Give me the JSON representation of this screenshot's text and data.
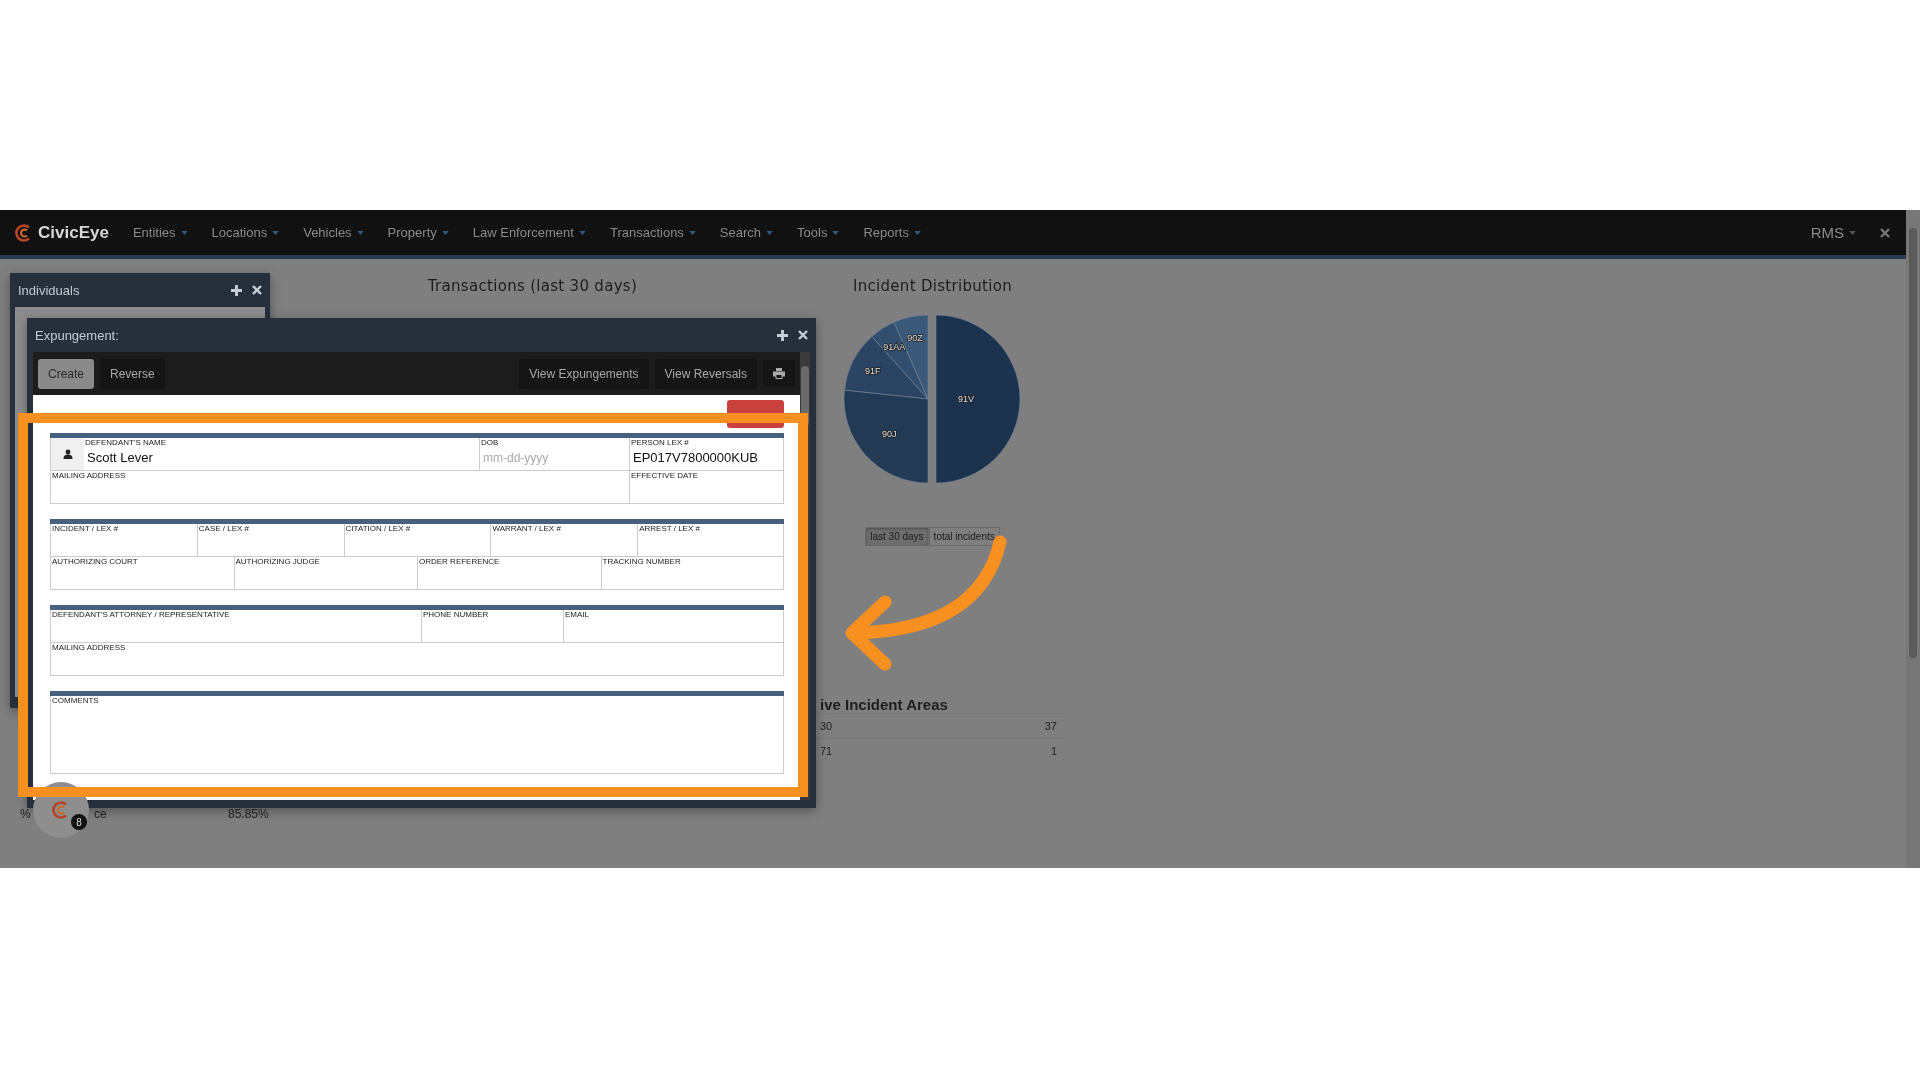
{
  "navbar": {
    "brand": "CivicEye",
    "items": [
      "Entities",
      "Locations",
      "Vehicles",
      "Property",
      "Law Enforcement",
      "Transactions",
      "Search",
      "Tools",
      "Reports"
    ],
    "user_menu": "RMS"
  },
  "dashboard": {
    "stat_row": {
      "column_1": "%",
      "column_2": "ce",
      "column_3": "85.85%"
    },
    "transactions_title": "Transactions (last 30 days)",
    "distribution": {
      "title": "Incident Distribution",
      "slice_labels": [
        "90Z",
        "91AA",
        "91F",
        "91V",
        "90J"
      ],
      "toggles": [
        {
          "label": "last 30 days",
          "selected": true
        },
        {
          "label": "total incidents",
          "selected": false
        }
      ]
    },
    "areas": {
      "heading": "ive Incident Areas",
      "rows": [
        {
          "area": "30",
          "count": "37"
        },
        {
          "area": "71",
          "count": "1"
        }
      ]
    }
  },
  "individuals_window": {
    "title": "Individuals"
  },
  "expungement_window": {
    "title": "Expungement:",
    "tabs": [
      {
        "label": "Create",
        "selected": true
      },
      {
        "label": "Reverse",
        "selected": false
      }
    ],
    "actions": [
      "View Expungements",
      "View Reversals"
    ],
    "form_sections": [
      {
        "lines": [
          {
            "fields": [
              {
                "kind": "person",
                "label": "DEFENDANT'S NAME",
                "value": "Scott Lever"
              },
              {
                "kind": "text",
                "label": "DOB",
                "placeholder": "mm-dd-yyyy"
              },
              {
                "kind": "text",
                "label": "PERSON LEX #",
                "value": "EP017V7800000KUB"
              }
            ]
          },
          {
            "fields": [
              {
                "kind": "text",
                "label": "MAILING ADDRESS"
              },
              {
                "kind": "text",
                "label": "EFFECTIVE DATE"
              }
            ]
          }
        ]
      },
      {
        "lines": [
          {
            "fields": [
              {
                "kind": "text",
                "label": "INCIDENT / LEX #"
              },
              {
                "kind": "text",
                "label": "CASE / LEX #"
              },
              {
                "kind": "text",
                "label": "CITATION / LEX #"
              },
              {
                "kind": "text",
                "label": "WARRANT / LEX #"
              },
              {
                "kind": "text",
                "label": "ARREST / LEX #"
              }
            ]
          },
          {
            "fields": [
              {
                "kind": "text",
                "label": "AUTHORIZING COURT"
              },
              {
                "kind": "text",
                "label": "AUTHORIZING JUDGE"
              },
              {
                "kind": "text",
                "label": "ORDER REFERENCE"
              },
              {
                "kind": "text",
                "label": "TRACKING NUMBER"
              }
            ]
          }
        ]
      },
      {
        "lines": [
          {
            "fields": [
              {
                "kind": "text",
                "label": "DEFENDANT'S ATTORNEY / REPRESENTATIVE"
              },
              {
                "kind": "text",
                "label": "PHONE NUMBER"
              },
              {
                "kind": "text",
                "label": "EMAIL"
              }
            ]
          },
          {
            "fields": [
              {
                "kind": "text",
                "label": "MAILING ADDRESS"
              }
            ]
          }
        ]
      },
      {
        "lines": [
          {
            "fields": [
              {
                "kind": "textarea",
                "label": "COMMENTS"
              }
            ]
          }
        ]
      }
    ]
  },
  "notification_badge": "8"
}
